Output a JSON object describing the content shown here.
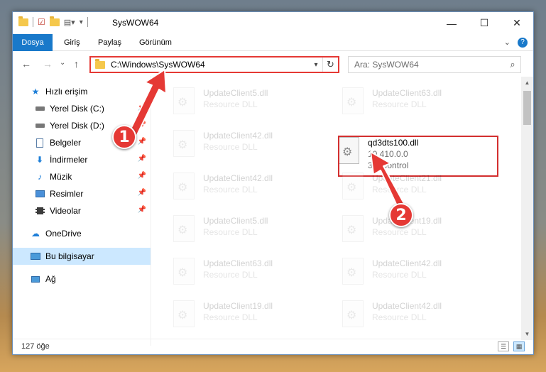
{
  "window": {
    "title": "SysWOW64",
    "controls": {
      "minimize": "—",
      "maximize": "☐",
      "close": "✕"
    }
  },
  "ribbon": {
    "tabs": [
      "Dosya",
      "Giriş",
      "Paylaş",
      "Görünüm"
    ],
    "help": "?"
  },
  "navbar": {
    "back": "←",
    "forward": "→",
    "recent": "⌄",
    "up": "↑",
    "address": "C:\\Windows\\SysWOW64",
    "refresh": "↻",
    "search_placeholder": "Ara: SysWOW64",
    "search_icon": "⌕"
  },
  "sidebar": {
    "items": [
      {
        "label": "Hızlı erişim",
        "icon": "star-icon",
        "pinned": false
      },
      {
        "label": "Yerel Disk (C:)",
        "icon": "drive-icon",
        "pinned": true
      },
      {
        "label": "Yerel Disk (D:)",
        "icon": "drive-icon",
        "pinned": true
      },
      {
        "label": "Belgeler",
        "icon": "documents-icon",
        "pinned": true
      },
      {
        "label": "İndirmeler",
        "icon": "download-icon",
        "pinned": true
      },
      {
        "label": "Müzik",
        "icon": "music-icon",
        "pinned": true
      },
      {
        "label": "Resimler",
        "icon": "pictures-icon",
        "pinned": true
      },
      {
        "label": "Videolar",
        "icon": "videos-icon",
        "pinned": true
      },
      {
        "label": "OneDrive",
        "icon": "cloud-icon",
        "pinned": false
      },
      {
        "label": "Bu bilgisayar",
        "icon": "computer-icon",
        "pinned": false,
        "selected": true
      },
      {
        "label": "Ağ",
        "icon": "network-icon",
        "pinned": false
      }
    ]
  },
  "files": {
    "left": [
      {
        "name": "UpdateClient5.dll",
        "type": "Resource DLL"
      },
      {
        "name": "UpdateClient42.dll",
        "type": "Resource DLL"
      },
      {
        "name": "UpdateClient42.dll",
        "type": "Resource DLL"
      },
      {
        "name": "UpdateClient5.dll",
        "type": "Resource DLL"
      },
      {
        "name": "UpdateClient63.dll",
        "type": "Resource DLL"
      },
      {
        "name": "UpdateClient19.dll",
        "type": "Resource DLL"
      }
    ],
    "right": [
      {
        "name": "UpdateClient63.dll",
        "type": "Resource DLL"
      },
      {
        "name": "qd3dts100.dll",
        "version": "10.410.0.0",
        "type": "3D Control",
        "highlighted": true
      },
      {
        "name": "UpdateClient21.dll",
        "type": "Resource DLL"
      },
      {
        "name": "UpdateClient19.dll",
        "type": "Resource DLL"
      },
      {
        "name": "UpdateClient42.dll",
        "type": "Resource DLL"
      },
      {
        "name": "UpdateClient42.dll",
        "type": "Resource DLL"
      }
    ]
  },
  "status": {
    "count": "127 öğe"
  },
  "annotations": {
    "step1": "1",
    "step2": "2",
    "color": "#e53935"
  }
}
